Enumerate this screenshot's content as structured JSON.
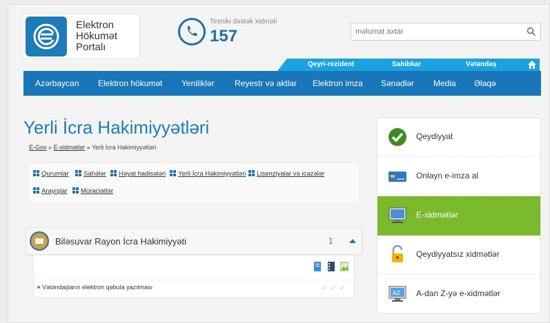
{
  "brand": {
    "line1": "Elektron",
    "line2": "Hökumət",
    "line3": "Portalı"
  },
  "support": {
    "label": "Texniki dəstək xidməti",
    "number": "157"
  },
  "search": {
    "placeholder": "məlumat axtar"
  },
  "audience_tabs": [
    "Qeyri-rezident",
    "Sahibkar",
    "Vətəndaş"
  ],
  "nav": [
    "Azərbaycan",
    "Elektron hökumət",
    "Yeniliklər",
    "Reyestr və aktlar",
    "Elektron imza",
    "Sənədlər",
    "Media",
    "Əlaqə"
  ],
  "page": {
    "title": "Yerli İcra Hakimiyyətləri",
    "breadcrumb": {
      "home": "E-Gov",
      "sep1": "»",
      "section": "E-xidmətlər",
      "sep2": "»",
      "current": "Yerli İcra Hakimiyyətləri"
    }
  },
  "filters": [
    "Qurumlar",
    "Sahələr",
    "Həyat hadisələri",
    "Yerli İcra Hakimiyyətləri",
    "Lisenziyalar və icazələr",
    "Arayışlar",
    "Müraciətlər"
  ],
  "org": {
    "name": "Biləsuvar Rayon İcra Hakimiyyəti",
    "count": "1",
    "services": [
      {
        "title": "Vətəndaşların elektron qəbula yazılması"
      }
    ]
  },
  "sidebar": [
    {
      "label": "Qeydiyyat",
      "icon": "check-icon",
      "active": false
    },
    {
      "label": "Onlayn e-imza al",
      "icon": "card-icon",
      "active": false
    },
    {
      "label": "E-xidmətlər",
      "icon": "monitor-icon",
      "active": true
    },
    {
      "label": "Qeydiyyatsız xidmətlər",
      "icon": "padlock-icon",
      "active": false
    },
    {
      "label": "A-dan Z-yə e-xidmətlər",
      "icon": "screen-az-icon",
      "active": false
    }
  ],
  "colors": {
    "brand_blue": "#1976b8",
    "light_blue": "#1aa3e0",
    "active_green": "#7ab82c",
    "count_green": "#3c9a1d"
  }
}
